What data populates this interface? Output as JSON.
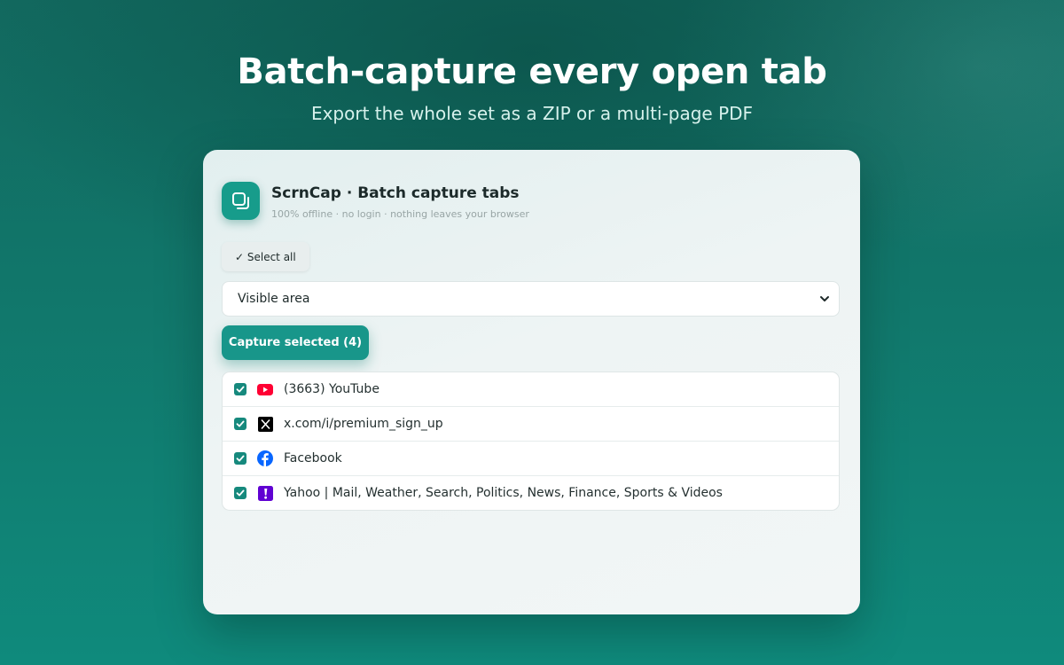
{
  "hero": {
    "title": "Batch-capture every open tab",
    "subtitle": "Export the whole set as a ZIP or a multi-page PDF"
  },
  "app": {
    "icon": "stacked-squares-icon",
    "title": "ScrnCap · Batch capture tabs",
    "tagline": "100% offline · no login · nothing leaves your browser"
  },
  "controls": {
    "select_all_label": "✓ Select all",
    "mode_value": "Visible area",
    "capture_label": "Capture selected (4)"
  },
  "tabs": [
    {
      "title": "(3663) YouTube",
      "icon": "youtube-icon",
      "checked": true
    },
    {
      "title": "x.com/i/premium_sign_up",
      "icon": "x-icon",
      "checked": true
    },
    {
      "title": "Facebook",
      "icon": "facebook-icon",
      "checked": true
    },
    {
      "title": "Yahoo | Mail, Weather, Search, Politics, News, Finance, Sports & Videos",
      "icon": "yahoo-icon",
      "checked": true
    }
  ],
  "colors": {
    "accent": "#18968a",
    "background_top": "#12695f",
    "background_bottom": "#0f8a7c"
  }
}
